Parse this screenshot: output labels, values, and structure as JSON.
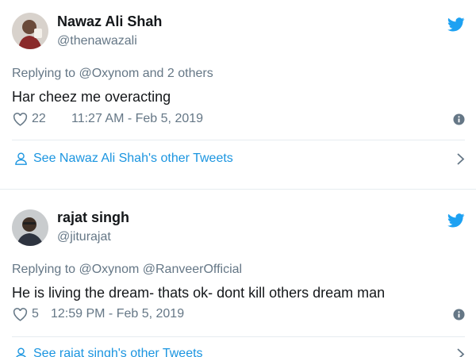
{
  "tweets": [
    {
      "display_name": "Nawaz Ali Shah",
      "handle": "@thenawazali",
      "replying_to": "Replying to @Oxynom and 2 others",
      "text": "Har cheez me overacting",
      "likes": "22",
      "timestamp": "11:27 AM - Feb 5, 2019",
      "see_more": "See Nawaz Ali Shah's other Tweets"
    },
    {
      "display_name": "rajat singh",
      "handle": "@jiturajat",
      "replying_to": "Replying to @Oxynom @RanveerOfficial",
      "text": "He is living the dream- thats ok- dont kill others dream man",
      "likes": "5",
      "timestamp": "12:59 PM - Feb 5, 2019",
      "see_more": "See rajat singh's other Tweets"
    }
  ],
  "icons": {
    "brand": "twitter-bird-icon",
    "like": "heart-outline-icon",
    "info": "info-circle-icon",
    "profile": "person-icon",
    "expand": "chevron-right-icon"
  },
  "colors": {
    "twitter_blue": "#1da1f2",
    "link_blue": "#1b95e0",
    "text_primary": "#14171a",
    "text_secondary": "#657786",
    "divider": "#e6ecf0"
  }
}
